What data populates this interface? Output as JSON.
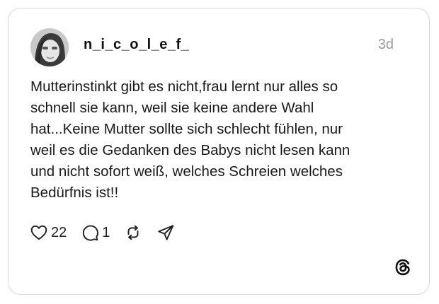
{
  "post": {
    "username": "n_i_c_o_l_e_f_",
    "timestamp": "3d",
    "text_lines": [
      "Mutterinstinkt gibt es nicht,frau lernt nur alles so",
      "schnell sie kann, weil sie keine andere Wahl",
      "hat...Keine Mutter sollte sich schlecht fühlen, nur",
      "weil es die Gedanken des Babys nicht lesen kann",
      "und nicht sofort weiß, welches Schreien welches",
      "Bedürfnis ist!!"
    ],
    "actions": {
      "like_count": "22",
      "reply_count": "1"
    },
    "icons": [
      "heart-icon",
      "comment-icon",
      "repost-icon",
      "share-icon",
      "threads-logo-icon"
    ]
  }
}
